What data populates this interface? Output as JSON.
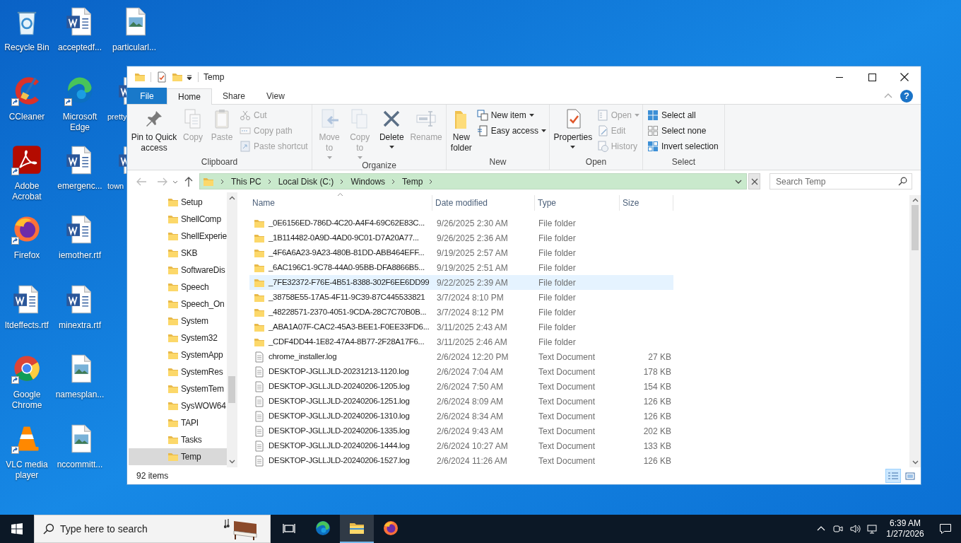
{
  "desktop": {
    "columns": [
      [
        {
          "label": "Recycle Bin",
          "kind": "recycle",
          "shortcut": false
        },
        {
          "label": "CCleaner",
          "kind": "ccleaner",
          "shortcut": true
        },
        {
          "label": "Adobe Acrobat",
          "kind": "acrobat",
          "shortcut": true
        },
        {
          "label": "Firefox",
          "kind": "firefox",
          "shortcut": true
        },
        {
          "label": "ltdeffects.rtf",
          "kind": "word",
          "shortcut": false
        },
        {
          "label": "Google Chrome",
          "kind": "chrome",
          "shortcut": true
        },
        {
          "label": "VLC media player",
          "kind": "vlc",
          "shortcut": true
        }
      ],
      [
        {
          "label": "acceptedf...",
          "kind": "word",
          "shortcut": false
        },
        {
          "label": "Microsoft Edge",
          "kind": "edge",
          "shortcut": true
        },
        {
          "label": "emergenc...",
          "kind": "word",
          "shortcut": false
        },
        {
          "label": "iemother.rtf",
          "kind": "word",
          "shortcut": false
        },
        {
          "label": "minextra.rtf",
          "kind": "word",
          "shortcut": false
        },
        {
          "label": "namesplan...",
          "kind": "image",
          "shortcut": false
        },
        {
          "label": "nccommitt...",
          "kind": "image",
          "shortcut": false
        }
      ],
      [
        {
          "label": "particularl...",
          "kind": "image",
          "shortcut": false
        },
        {
          "label": "pretty",
          "kind": "word",
          "shortcut": false
        },
        {
          "label": "town",
          "kind": "word",
          "shortcut": false
        }
      ]
    ]
  },
  "window": {
    "title": "Temp",
    "ribbon": {
      "file_tab": "File",
      "help_glyph": "?",
      "tabs": [
        {
          "label": "Home",
          "selected": true
        },
        {
          "label": "Share",
          "selected": false
        },
        {
          "label": "View",
          "selected": false
        }
      ],
      "groups": [
        {
          "label": "Clipboard",
          "items": [
            {
              "kind": "large",
              "label": "Pin to Quick access",
              "disabled": false,
              "dropdown": false
            },
            {
              "kind": "large",
              "label": "Copy",
              "disabled": true,
              "dropdown": false
            },
            {
              "kind": "large",
              "label": "Paste",
              "disabled": true,
              "dropdown": false
            },
            {
              "kind": "small",
              "label": "Cut",
              "disabled": true,
              "dropdown": false
            },
            {
              "kind": "small",
              "label": "Copy path",
              "disabled": true,
              "dropdown": false
            },
            {
              "kind": "small",
              "label": "Paste shortcut",
              "disabled": true,
              "dropdown": false
            }
          ]
        },
        {
          "label": "Organize",
          "items": [
            {
              "kind": "large",
              "label": "Move to",
              "disabled": true,
              "dropdown": true
            },
            {
              "kind": "large",
              "label": "Copy to",
              "disabled": true,
              "dropdown": true
            },
            {
              "kind": "large",
              "label": "Delete",
              "disabled": false,
              "dropdown": true
            },
            {
              "kind": "large",
              "label": "Rename",
              "disabled": true,
              "dropdown": false
            }
          ]
        },
        {
          "label": "New",
          "items": [
            {
              "kind": "large",
              "label": "New folder",
              "disabled": false,
              "dropdown": false
            },
            {
              "kind": "small",
              "label": "New item",
              "disabled": false,
              "dropdown": true
            },
            {
              "kind": "small",
              "label": "Easy access",
              "disabled": false,
              "dropdown": true
            }
          ]
        },
        {
          "label": "Open",
          "items": [
            {
              "kind": "large",
              "label": "Properties",
              "disabled": false,
              "dropdown": true
            },
            {
              "kind": "small",
              "label": "Open",
              "disabled": true,
              "dropdown": true
            },
            {
              "kind": "small",
              "label": "Edit",
              "disabled": true,
              "dropdown": false
            },
            {
              "kind": "small",
              "label": "History",
              "disabled": true,
              "dropdown": false
            }
          ]
        },
        {
          "label": "Select",
          "items": [
            {
              "kind": "small",
              "label": "Select all",
              "disabled": false,
              "dropdown": false
            },
            {
              "kind": "small",
              "label": "Select none",
              "disabled": false,
              "dropdown": false
            },
            {
              "kind": "small",
              "label": "Invert selection",
              "disabled": false,
              "dropdown": false
            }
          ]
        }
      ]
    },
    "address": {
      "crumbs": [
        "This PC",
        "Local Disk (C:)",
        "Windows",
        "Temp"
      ],
      "search_placeholder": "Search Temp"
    },
    "nav_pane": [
      {
        "label": "Setup",
        "selected": false
      },
      {
        "label": "ShellComp",
        "selected": false
      },
      {
        "label": "ShellExperie",
        "selected": false
      },
      {
        "label": "SKB",
        "selected": false
      },
      {
        "label": "SoftwareDis",
        "selected": false
      },
      {
        "label": "Speech",
        "selected": false
      },
      {
        "label": "Speech_On",
        "selected": false
      },
      {
        "label": "System",
        "selected": false
      },
      {
        "label": "System32",
        "selected": false
      },
      {
        "label": "SystemApp",
        "selected": false
      },
      {
        "label": "SystemRes",
        "selected": false
      },
      {
        "label": "SystemTem",
        "selected": false
      },
      {
        "label": "SysWOW64",
        "selected": false
      },
      {
        "label": "TAPI",
        "selected": false
      },
      {
        "label": "Tasks",
        "selected": false
      },
      {
        "label": "Temp",
        "selected": true
      }
    ],
    "columns": [
      "Name",
      "Date modified",
      "Type",
      "Size"
    ],
    "files": [
      {
        "kind": "folder",
        "name": "_0E6156ED-786D-4C20-A4F4-69C62E83C...",
        "date": "9/26/2025 2:30 AM",
        "type": "File folder",
        "selected": false
      },
      {
        "kind": "folder",
        "name": "_1B114482-0A9D-4AD0-9C01-D7A20A77...",
        "date": "9/26/2025 2:36 AM",
        "type": "File folder",
        "selected": false
      },
      {
        "kind": "folder",
        "name": "_4F6A6A23-9A23-480B-81DD-ABB464EFF...",
        "date": "9/19/2025 2:57 AM",
        "type": "File folder",
        "selected": false
      },
      {
        "kind": "folder",
        "name": "_6AC196C1-9C78-44A0-95BB-DFA8866B5...",
        "date": "9/19/2025 2:51 AM",
        "type": "File folder",
        "selected": false
      },
      {
        "kind": "folder",
        "name": "_7FE32372-F76E-4B51-8388-302F6EE6DD99",
        "date": "9/22/2025 2:39 AM",
        "type": "File folder",
        "selected": true
      },
      {
        "kind": "folder",
        "name": "_38758E55-17A5-4F11-9C39-87C445533821",
        "date": "3/7/2024 8:10 PM",
        "type": "File folder",
        "selected": false
      },
      {
        "kind": "folder",
        "name": "_48228571-2370-4051-9CDA-28C7C70B0B...",
        "date": "3/7/2024 8:12 PM",
        "type": "File folder",
        "selected": false
      },
      {
        "kind": "folder",
        "name": "_ABA1A07F-CAC2-45A3-BEE1-F0EE33FD6...",
        "date": "3/11/2025 2:43 AM",
        "type": "File folder",
        "selected": false
      },
      {
        "kind": "folder",
        "name": "_CDF4DD44-1E82-47A4-8B77-2F28A17F6...",
        "date": "3/11/2025 2:46 AM",
        "type": "File folder",
        "selected": false
      },
      {
        "kind": "file",
        "name": "chrome_installer.log",
        "date": "2/6/2024 12:20 PM",
        "type": "Text Document",
        "size": "27 KB",
        "selected": false
      },
      {
        "kind": "file",
        "name": "DESKTOP-JGLLJLD-20231213-1120.log",
        "date": "2/6/2024 7:04 AM",
        "type": "Text Document",
        "size": "178 KB",
        "selected": false
      },
      {
        "kind": "file",
        "name": "DESKTOP-JGLLJLD-20240206-1205.log",
        "date": "2/6/2024 7:50 AM",
        "type": "Text Document",
        "size": "154 KB",
        "selected": false
      },
      {
        "kind": "file",
        "name": "DESKTOP-JGLLJLD-20240206-1251.log",
        "date": "2/6/2024 8:09 AM",
        "type": "Text Document",
        "size": "126 KB",
        "selected": false
      },
      {
        "kind": "file",
        "name": "DESKTOP-JGLLJLD-20240206-1310.log",
        "date": "2/6/2024 8:34 AM",
        "type": "Text Document",
        "size": "126 KB",
        "selected": false
      },
      {
        "kind": "file",
        "name": "DESKTOP-JGLLJLD-20240206-1335.log",
        "date": "2/6/2024 9:43 AM",
        "type": "Text Document",
        "size": "202 KB",
        "selected": false
      },
      {
        "kind": "file",
        "name": "DESKTOP-JGLLJLD-20240206-1444.log",
        "date": "2/6/2024 10:27 AM",
        "type": "Text Document",
        "size": "133 KB",
        "selected": false
      },
      {
        "kind": "file",
        "name": "DESKTOP-JGLLJLD-20240206-1527.log",
        "date": "2/6/2024 11:26 AM",
        "type": "Text Document",
        "size": "126 KB",
        "selected": false
      }
    ],
    "status": "92 items",
    "views": [
      {
        "kind": "details",
        "selected": true
      },
      {
        "kind": "large_icons",
        "selected": false
      }
    ]
  },
  "taskbar": {
    "search_placeholder": "Type here to search",
    "apps": [
      {
        "kind": "task_view",
        "active": false
      },
      {
        "kind": "edge",
        "active": false
      },
      {
        "kind": "explorer",
        "active": true
      },
      {
        "kind": "firefox",
        "active": false
      }
    ],
    "time": "6:39 AM",
    "date": "1/27/2026"
  }
}
